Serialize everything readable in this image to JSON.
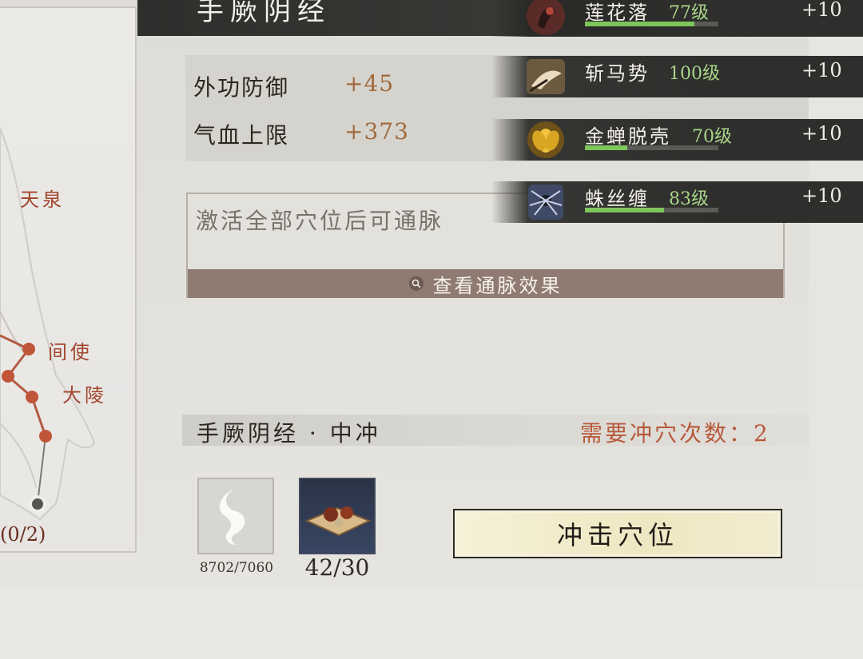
{
  "header": {
    "title": "手厥阴经"
  },
  "map": {
    "acupoints": [
      "天泉",
      "间使",
      "大陵"
    ],
    "count": "(0/2)"
  },
  "stats": [
    {
      "name": "外功防御",
      "value": "+45"
    },
    {
      "name": "气血上限",
      "value": "+373"
    }
  ],
  "tongmai": {
    "hint": "激活全部穴位后可通脉",
    "button_label": "查看通脉效果"
  },
  "skills": [
    {
      "name": "莲花落",
      "level": "77级",
      "bonus": "+10",
      "progress": 0.82
    },
    {
      "name": "斩马势",
      "level": "100级",
      "bonus": "+10",
      "progress": 0.0
    },
    {
      "name": "金蝉脱壳",
      "level": "70级",
      "bonus": "+10",
      "progress": 0.32
    },
    {
      "name": "蛛丝缠",
      "level": "83级",
      "bonus": "+10",
      "progress": 0.59
    }
  ],
  "acupoint": {
    "title": "手厥阴经 · 中冲",
    "requirement": "需要冲穴次数：2"
  },
  "items": [
    {
      "icon": "qi-swirl-icon",
      "count": "8702/7060"
    },
    {
      "icon": "medicine-pills-icon",
      "count": "42/30"
    }
  ],
  "action": {
    "label": "冲击穴位"
  }
}
